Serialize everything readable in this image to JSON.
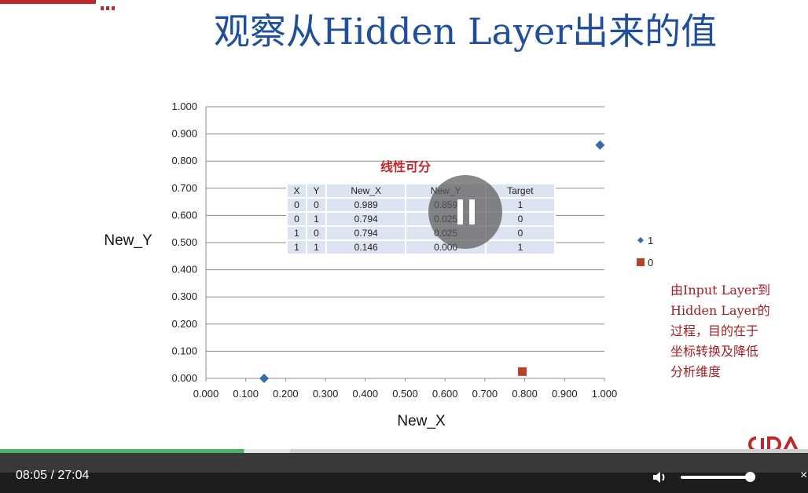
{
  "slide": {
    "title": "观察从Hidden Layer出来的值",
    "table_caption": "线性可分",
    "annotation_lines": [
      "由Input Layer到",
      "Hidden Layer的",
      "过程，目的在于",
      "坐标转换及降低",
      "分析维度"
    ],
    "brand_color": "#c0282d",
    "title_color": "#1f4e9c"
  },
  "table": {
    "headers": [
      "X",
      "Y",
      "New_X",
      "New_Y",
      "Target"
    ],
    "rows": [
      [
        "0",
        "0",
        "0.989",
        "0.859",
        "1"
      ],
      [
        "0",
        "1",
        "0.794",
        "0.025",
        "0"
      ],
      [
        "1",
        "0",
        "0.794",
        "0.025",
        "0"
      ],
      [
        "1",
        "1",
        "0.146",
        "0.000",
        "1"
      ]
    ]
  },
  "chart_data": {
    "type": "scatter",
    "title": "",
    "xlabel": "New_X",
    "ylabel": "New_Y",
    "xlim": [
      0,
      1
    ],
    "ylim": [
      0,
      1
    ],
    "x_ticks": [
      "0.000",
      "0.100",
      "0.200",
      "0.300",
      "0.400",
      "0.500",
      "0.600",
      "0.700",
      "0.800",
      "0.900",
      "1.000"
    ],
    "y_ticks": [
      "0.000",
      "0.100",
      "0.200",
      "0.300",
      "0.400",
      "0.500",
      "0.600",
      "0.700",
      "0.800",
      "0.900",
      "1.000"
    ],
    "grid": "horizontal",
    "legend_position": "right",
    "series": [
      {
        "name": "1",
        "marker": "diamond",
        "color": "#3a6aa8",
        "points": [
          [
            0.989,
            0.859
          ],
          [
            0.146,
            0.0
          ]
        ]
      },
      {
        "name": "0",
        "marker": "square",
        "color": "#b5422c",
        "points": [
          [
            0.794,
            0.025
          ]
        ]
      }
    ]
  },
  "player": {
    "time_text": "08:05 / 27:04",
    "progress_fraction": 0.302,
    "buffered_fraction": 0.359,
    "volume_fraction": 0.95,
    "close_label": "×",
    "accent_color": "#4caf6a",
    "play_state": "pause-icon",
    "volume_icon": "speaker-icon"
  }
}
